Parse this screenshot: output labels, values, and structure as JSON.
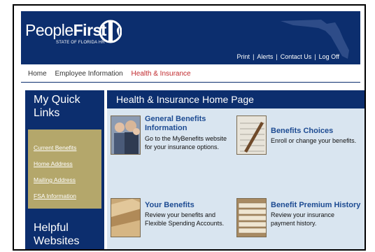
{
  "header": {
    "logo_text_light": "People",
    "logo_text_bold": "First",
    "logo_subtitle": "STATE OF FLORIDA HR",
    "utility_links": [
      "Print",
      "Alerts",
      "Contact Us",
      "Log Off"
    ],
    "utility_separator": "|"
  },
  "nav": {
    "items": [
      {
        "label": "Home",
        "active": false
      },
      {
        "label": "Employee Information",
        "active": false
      },
      {
        "label": "Health & Insurance",
        "active": true
      }
    ]
  },
  "sidebar": {
    "quick_links_title": "My Quick Links",
    "quick_links": [
      "Current Benefits",
      "Home Address",
      "Mailing Address",
      "FSA Information"
    ],
    "helpful_title": "Helpful Websites"
  },
  "main": {
    "title": "Health & Insurance Home Page",
    "tiles": [
      {
        "title_line1": "General Benefits",
        "title_line2": "Information",
        "desc_line1": "Go to the MyBenefits website",
        "desc_line2": "for your insurance options.",
        "icon": "people-photo-icon"
      },
      {
        "title_line1": "Benefits Choices",
        "title_line2": "",
        "desc_line1": "Enroll or change your benefits.",
        "desc_line2": "",
        "icon": "form-pen-photo-icon"
      },
      {
        "title_line1": "Your Benefits",
        "title_line2": "",
        "desc_line1": "Review your benefits and",
        "desc_line2": "Flexible Spending Accounts.",
        "icon": "file-folders-photo-icon"
      },
      {
        "title_line1": "Benefit Premium History",
        "title_line2": "",
        "desc_line1": "Review your insurance",
        "desc_line2": "payment history.",
        "icon": "file-cards-photo-icon"
      }
    ]
  },
  "colors": {
    "navy": "#0c2e6e",
    "gold": "#b4a76b",
    "panel": "#d9e5f0",
    "nav_active": "#c0282d",
    "tile_title": "#1d4b92"
  }
}
